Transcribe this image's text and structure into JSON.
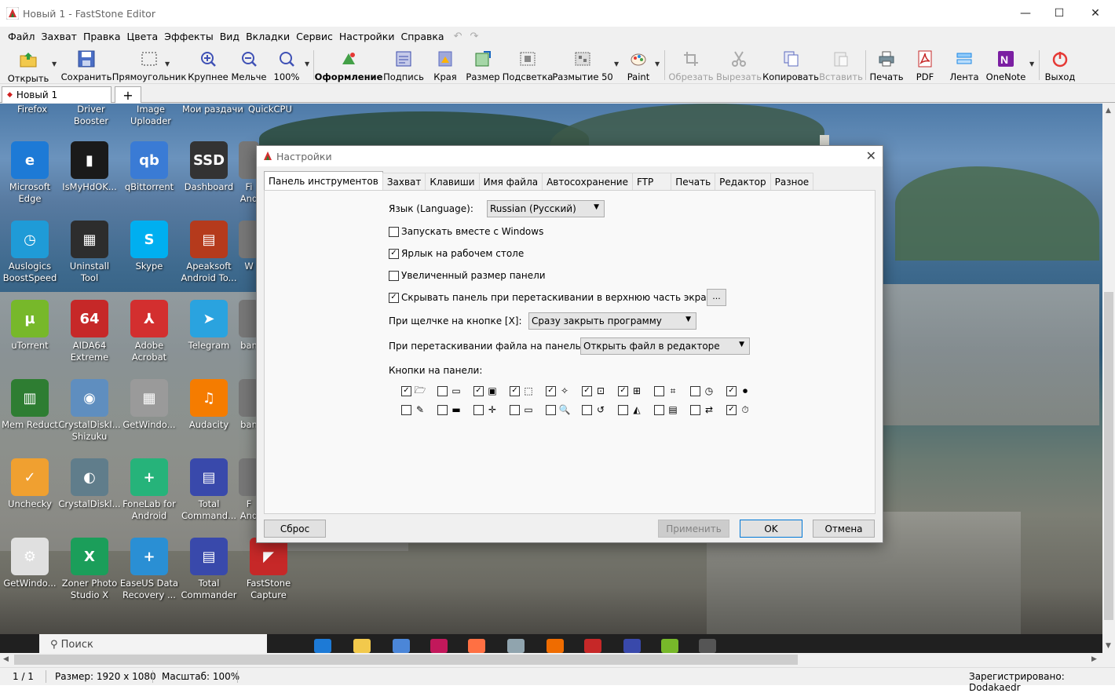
{
  "window": {
    "title": "Новый 1 - FastStone Editor",
    "minimize": "—",
    "maximize": "☐",
    "close": "✕"
  },
  "menu": [
    "Файл",
    "Захват",
    "Правка",
    "Цвета",
    "Эффекты",
    "Вид",
    "Вкладки",
    "Сервис",
    "Настройки",
    "Справка"
  ],
  "toolbar": {
    "open": "Открыть",
    "save": "Сохранить",
    "rect": "Прямоугольник",
    "zoom_in": "Крупнее",
    "zoom_out": "Мельче",
    "zoom": "100%",
    "decor": "Оформление",
    "caption": "Подпись",
    "edges": "Края",
    "resize": "Размер",
    "highlight": "Подсветка",
    "blur": "Размытие 50",
    "paint": "Paint",
    "crop": "Обрезать",
    "cut": "Вырезать",
    "copy": "Копировать",
    "paste": "Вставить",
    "print": "Печать",
    "pdf": "PDF",
    "ribbon": "Лента",
    "onenote": "OneNote",
    "exit": "Выход"
  },
  "tabs": {
    "doc": "Новый 1",
    "add": "+"
  },
  "desktop": {
    "top_labels": [
      "Firefox",
      "Driver\nBooster",
      "Image\nUploader",
      "Мои раздачи",
      "QuickCPU"
    ],
    "icons": [
      {
        "label": "Microsoft Edge",
        "color": "#1d7ad6"
      },
      {
        "label": "IsMyHdOK...",
        "color": "#1a1a1a"
      },
      {
        "label": "qBittorrent",
        "color": "#3a7bd5"
      },
      {
        "label": "Dashboard",
        "color": "#333333"
      },
      {
        "label": "Auslogics BoostSpeed",
        "color": "#1f9bd7"
      },
      {
        "label": "Uninstall Tool",
        "color": "#2d2d2d"
      },
      {
        "label": "Skype",
        "color": "#00aff0"
      },
      {
        "label": "Apeaksoft Android To...",
        "color": "#b53a1c"
      },
      {
        "label": "uTorrent",
        "color": "#77b82a"
      },
      {
        "label": "AIDA64 Extreme",
        "color": "#c62828"
      },
      {
        "label": "Adobe Acrobat",
        "color": "#d32f2f"
      },
      {
        "label": "Telegram",
        "color": "#2aa3df"
      },
      {
        "label": "Mem Reduct",
        "color": "#2e7d32"
      },
      {
        "label": "CrystalDiskI... Shizuku",
        "color": "#5f8ebf"
      },
      {
        "label": "GetWindo...",
        "color": "#9a9a9a"
      },
      {
        "label": "Audacity",
        "color": "#f57c00"
      },
      {
        "label": "Unchecky",
        "color": "#f0a030"
      },
      {
        "label": "CrystalDiskl...",
        "color": "#607d8b"
      },
      {
        "label": "FoneLab for Android",
        "color": "#26b37a"
      },
      {
        "label": "Total Command...",
        "color": "#3949ab"
      },
      {
        "label": "GetWindo...",
        "color": "#e0e0e0"
      },
      {
        "label": "Zoner Photo Studio X",
        "color": "#1b9e5a"
      },
      {
        "label": "EaseUS Data Recovery ...",
        "color": "#2a8fd4"
      },
      {
        "label": "Total Commander",
        "color": "#3949ab"
      },
      {
        "label": "FastStone Capture",
        "color": "#c62828"
      }
    ],
    "partial_labels": [
      "Fi And",
      "W",
      "ban",
      "ban",
      "F And"
    ],
    "icon_glyphs": [
      "e",
      "▮",
      "qb",
      "SSD",
      "◷",
      "▦",
      "S",
      "▤",
      "µ",
      "64",
      "⅄",
      "➤",
      "▥",
      "◉",
      "▦",
      "♫",
      "✓",
      "◐",
      "+",
      "▤",
      "⚙",
      "X",
      "+",
      "▤",
      "◤"
    ]
  },
  "taskbar": {
    "search": "Поиск"
  },
  "status": {
    "pages": "1 / 1",
    "size": "Размер: 1920 x 1080",
    "scale": "Масштаб: 100%",
    "reg": "Зарегистрировано: Dodakaedr"
  },
  "dialog": {
    "title": "Настройки",
    "close": "✕",
    "tabs": [
      "Панель инструментов",
      "Захват",
      "Клавиши",
      "Имя файла",
      "Автосохранение",
      "FTP",
      "Печать",
      "Редактор",
      "Разное"
    ],
    "lang_label": "Язык (Language):",
    "lang_value": "Russian (Русский)",
    "opt1": "Запускать вместе с Windows",
    "opt1_checked": false,
    "opt2": "Ярлык на рабочем столе",
    "opt2_checked": true,
    "opt3": "Увеличенный размер панели",
    "opt3_checked": false,
    "opt4": "Скрывать панель при перетаскивании в верхнюю часть экрана",
    "opt4_checked": true,
    "dots": "...",
    "x_label": "При щелчке на кнопке [X]:",
    "x_value": "Сразу закрыть программу",
    "drag_label": "При перетаскивании файла на панель:",
    "drag_value": "Открыть файл в редакторе",
    "buttons_label": "Кнопки на панели:",
    "panel_buttons": [
      {
        "checked": true,
        "icon": "open-folder-icon",
        "glyph": "🗁"
      },
      {
        "checked": false,
        "icon": "window-icon",
        "glyph": "▭"
      },
      {
        "checked": true,
        "icon": "window-capture-icon",
        "glyph": "▣"
      },
      {
        "checked": true,
        "icon": "rect-select-icon",
        "glyph": "⬚"
      },
      {
        "checked": true,
        "icon": "freehand-icon",
        "glyph": "✧"
      },
      {
        "checked": true,
        "icon": "fullscreen-icon",
        "glyph": "⊡"
      },
      {
        "checked": true,
        "icon": "scroll-capture-icon",
        "glyph": "⊞"
      },
      {
        "checked": false,
        "icon": "fixed-region-icon",
        "glyph": "⌗"
      },
      {
        "checked": false,
        "icon": "timer-icon",
        "glyph": "◷"
      },
      {
        "checked": true,
        "icon": "video-icon",
        "glyph": "⏺"
      },
      {
        "checked": false,
        "icon": "color-picker-icon",
        "glyph": "✎"
      },
      {
        "checked": false,
        "icon": "ruler-icon",
        "glyph": "▬"
      },
      {
        "checked": false,
        "icon": "crosshair-icon",
        "glyph": "✛"
      },
      {
        "checked": false,
        "icon": "screen-ruler-icon",
        "glyph": "▭"
      },
      {
        "checked": false,
        "icon": "magnifier-icon",
        "glyph": "🔍"
      },
      {
        "checked": false,
        "icon": "repeat-icon",
        "glyph": "↺"
      },
      {
        "checked": false,
        "icon": "editor-icon",
        "glyph": "◭"
      },
      {
        "checked": false,
        "icon": "pdf-icon",
        "glyph": "▤"
      },
      {
        "checked": false,
        "icon": "convert-icon",
        "glyph": "⇄"
      },
      {
        "checked": true,
        "icon": "settings-timer-icon",
        "glyph": "⏱"
      }
    ],
    "reset": "Сброс",
    "apply": "Применить",
    "ok": "OK",
    "cancel": "Отмена"
  }
}
